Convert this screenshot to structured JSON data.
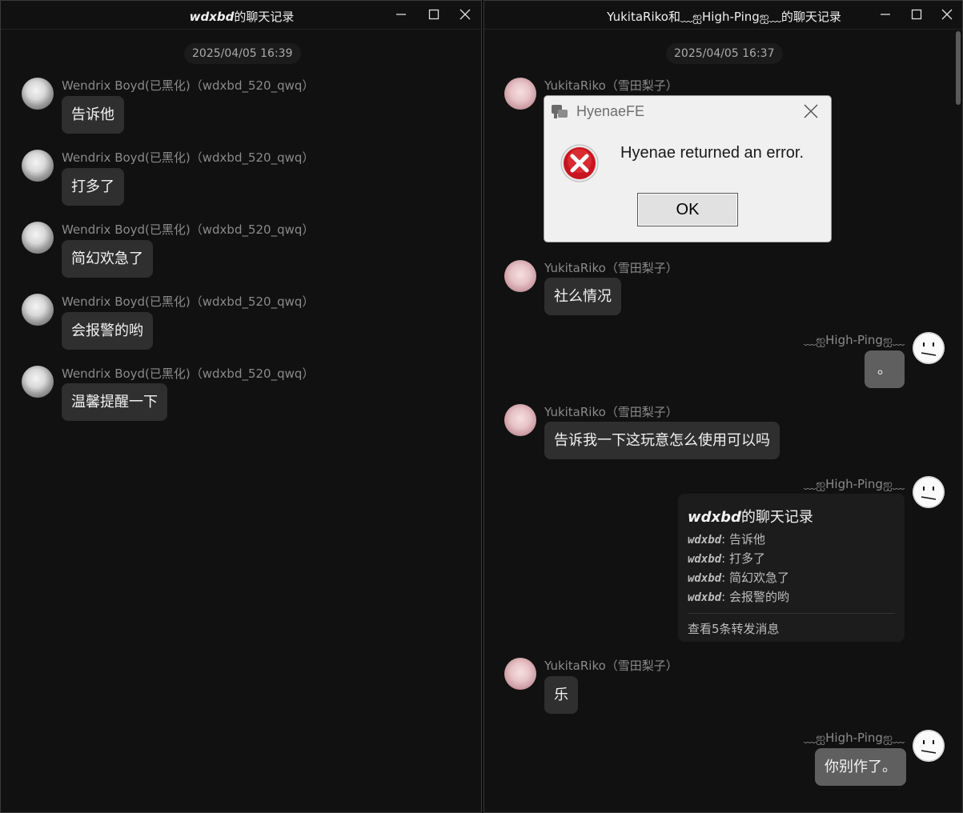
{
  "left_window": {
    "title_user": "wdxbd",
    "title_suffix": "的聊天记录",
    "controls": [
      "minimize-icon",
      "maximize-icon",
      "close-icon"
    ],
    "timestamp": "2025/04/05 16:39",
    "messages": [
      {
        "sender": "Wendrix Boyd(已黑化)（wdxbd_520_qwq）",
        "text": "告诉他"
      },
      {
        "sender": "Wendrix Boyd(已黑化)（wdxbd_520_qwq）",
        "text": "打多了"
      },
      {
        "sender": "Wendrix Boyd(已黑化)（wdxbd_520_qwq）",
        "text": "简幻欢急了"
      },
      {
        "sender": "Wendrix Boyd(已黑化)（wdxbd_520_qwq）",
        "text": "会报警的哟"
      },
      {
        "sender": "Wendrix Boyd(已黑化)（wdxbd_520_qwq）",
        "text": "温馨提醒一下"
      }
    ]
  },
  "right_window": {
    "title": "YukitaRiko和﹏ஐHigh-Pingஐ﹏的聊天记录",
    "timestamp": "2025/04/05 16:37",
    "messages": [
      {
        "sender": "YukitaRiko（雪田梨子）",
        "text": ""
      },
      {
        "sender": "YukitaRiko（雪田梨子）",
        "text": "社么情况"
      },
      {
        "sender": "﹏ஐHigh-Pingஐ﹏",
        "text": "。"
      },
      {
        "sender": "YukitaRiko（雪田梨子）",
        "text": "告诉我一下这玩意怎么使用可以吗"
      },
      {
        "sender": "﹏ஐHigh-Pingஐ﹏",
        "text": ""
      },
      {
        "sender": "YukitaRiko（雪田梨子）",
        "text": "乐"
      },
      {
        "sender": "﹏ஐHigh-Pingஐ﹏",
        "text": "你别作了。"
      }
    ],
    "forward_card": {
      "title_user": "wdxbd",
      "title_suffix": "的聊天记录",
      "lines": [
        {
          "user": "wdxbd",
          "text": ": 告诉他"
        },
        {
          "user": "wdxbd",
          "text": ": 打多了"
        },
        {
          "user": "wdxbd",
          "text": ": 简幻欢急了"
        },
        {
          "user": "wdxbd",
          "text": ": 会报警的哟"
        }
      ],
      "footer": "查看5条转发消息"
    }
  },
  "dialog": {
    "title": "HyenaeFE",
    "message": "Hyenae returned an error.",
    "ok_label": "OK",
    "icon": "error-icon"
  }
}
